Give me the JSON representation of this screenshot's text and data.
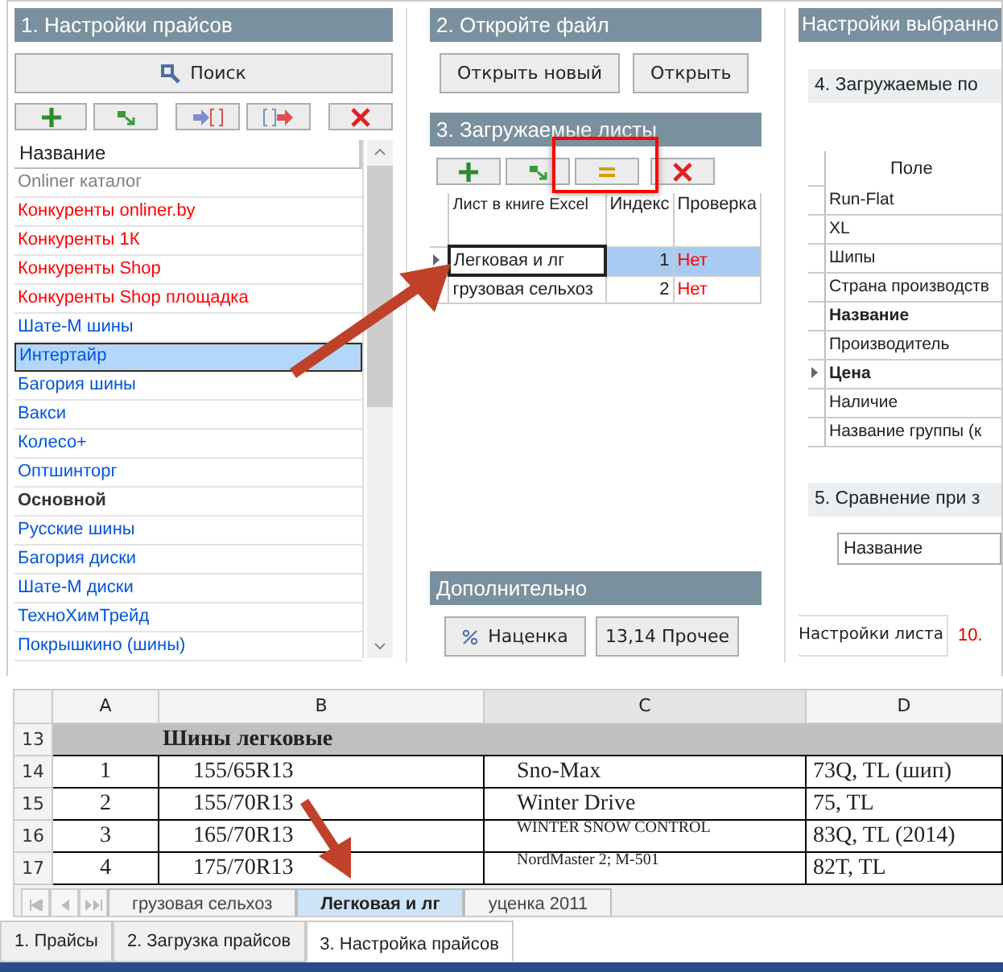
{
  "price_settings": {
    "title": "1. Настройки прайсов",
    "search_button": "Поиск",
    "list_column": "Название",
    "items": [
      {
        "name": "Onliner каталог",
        "color": "#808080",
        "bold": false,
        "selected": false
      },
      {
        "name": "Конкуренты onliner.by",
        "color": "#ff0000",
        "bold": false,
        "selected": false
      },
      {
        "name": "Конкуренты 1К",
        "color": "#ff0000",
        "bold": false,
        "selected": false
      },
      {
        "name": "Конкуренты Shop",
        "color": "#ff0000",
        "bold": false,
        "selected": false
      },
      {
        "name": "Конкуренты Shop площадка",
        "color": "#ff0000",
        "bold": false,
        "selected": false
      },
      {
        "name": "Шате-М шины",
        "color": "#0055dd",
        "bold": false,
        "selected": false
      },
      {
        "name": "Интертайр",
        "color": "#0055dd",
        "bold": false,
        "selected": true
      },
      {
        "name": "Багория шины",
        "color": "#0055dd",
        "bold": false,
        "selected": false
      },
      {
        "name": "Вакси",
        "color": "#0055dd",
        "bold": false,
        "selected": false
      },
      {
        "name": "Колесо+",
        "color": "#0055dd",
        "bold": false,
        "selected": false
      },
      {
        "name": "Оптшинторг",
        "color": "#0055dd",
        "bold": false,
        "selected": false
      },
      {
        "name": "Основной",
        "color": "#333333",
        "bold": true,
        "selected": false
      },
      {
        "name": "Русские шины",
        "color": "#0055dd",
        "bold": false,
        "selected": false
      },
      {
        "name": "Багория диски",
        "color": "#0055dd",
        "bold": false,
        "selected": false
      },
      {
        "name": "Шате-М диски",
        "color": "#0055dd",
        "bold": false,
        "selected": false
      },
      {
        "name": "ТехноХимТрейд",
        "color": "#0055dd",
        "bold": false,
        "selected": false
      },
      {
        "name": "Покрышкино (шины)",
        "color": "#0055dd",
        "bold": false,
        "selected": false
      }
    ]
  },
  "open_file": {
    "title": "2. Откройте файл",
    "buttons": [
      "Открыть новый",
      "Открыть"
    ]
  },
  "sheets": {
    "title": "3. Загружаемые листы",
    "columns": [
      "Лист в книге Excel",
      "Индекс",
      "Проверка"
    ],
    "rows": [
      {
        "name": "Легковая и лг",
        "index": "1",
        "check": "Нет",
        "selected": true
      },
      {
        "name": "грузовая сельхоз",
        "index": "2",
        "check": "Нет",
        "selected": false
      }
    ]
  },
  "extra": {
    "title": "Дополнительно",
    "buttons": [
      "Наценка",
      "13,14 Прочее"
    ]
  },
  "selected_settings": {
    "title": "Настройки выбранно",
    "fields_title": "4. Загружаемые по",
    "fields_column": "Поле",
    "fields": [
      {
        "name": "Run-Flat",
        "bold": false,
        "current": false
      },
      {
        "name": "XL",
        "bold": false,
        "current": false
      },
      {
        "name": "Шипы",
        "bold": false,
        "current": false
      },
      {
        "name": "Страна производств",
        "bold": false,
        "current": false
      },
      {
        "name": "Название",
        "bold": true,
        "current": false
      },
      {
        "name": "Производитель",
        "bold": false,
        "current": false
      },
      {
        "name": "Цена",
        "bold": true,
        "current": true
      },
      {
        "name": "Наличие",
        "bold": false,
        "current": false
      },
      {
        "name": "Название группы (к",
        "bold": false,
        "current": false
      }
    ],
    "compare_title": "5. Сравнение при з",
    "compare_value": "Название",
    "sheet_settings_button": "Настройки листа",
    "note": "10."
  },
  "spreadsheet": {
    "columns": [
      "A",
      "B",
      "C",
      "D"
    ],
    "rows": [
      {
        "number": "13",
        "kind": "group",
        "cells": [
          "",
          "Шины легковые",
          "",
          ""
        ]
      },
      {
        "number": "14",
        "kind": "data",
        "cells": [
          "1",
          "155/65R13",
          "Sno-Max",
          "73Q, TL (шип)"
        ]
      },
      {
        "number": "15",
        "kind": "data",
        "cells": [
          "2",
          "155/70R13",
          "Winter Drive",
          "75, TL"
        ]
      },
      {
        "number": "16",
        "kind": "data",
        "cells": [
          "3",
          "165/70R13",
          "WINTER SNOW CONTROL",
          "83Q, TL (2014)"
        ]
      },
      {
        "number": "17",
        "kind": "data",
        "cells": [
          "4",
          "175/70R13",
          "NordMaster 2; M-501",
          "82T, TL"
        ]
      }
    ],
    "sheet_tabs": [
      {
        "label": "грузовая сельхоз",
        "selected": false
      },
      {
        "label": "Легковая и лг",
        "selected": true
      },
      {
        "label": "уценка 2011",
        "selected": false
      }
    ]
  },
  "tabs": [
    {
      "label": "1. Прайсы",
      "selected": false
    },
    {
      "label": "2. Загрузка прайсов",
      "selected": false
    },
    {
      "label": "3. Настройка прайсов",
      "selected": true
    }
  ]
}
